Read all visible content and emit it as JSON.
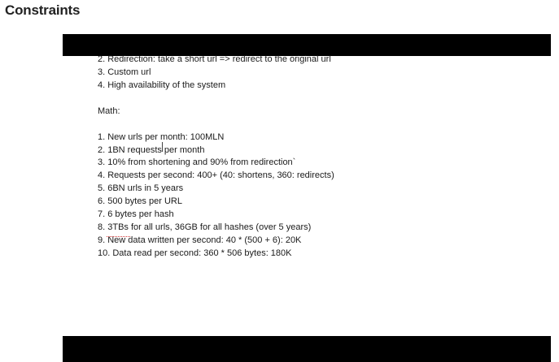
{
  "section": {
    "title": "Constraints"
  },
  "document": {
    "lines": {
      "l2": "2. Redirection: take a short url => redirect to the original url",
      "l3": "3. Custom url",
      "l4": "4. High availability of the system",
      "math_heading": "Math:",
      "m1": "1. New urls per month: 100MLN",
      "m2": "2. 1BN requests per month",
      "m3": "3. 10% from shortening and 90% from redirection`",
      "m4": "4. Requests per second: 400+ (40: shortens, 360: redirects)",
      "m5": "5. 6BN urls in 5 years",
      "m6": "6. 500 bytes per URL",
      "m7": "7. 6 bytes per hash",
      "m8": "8. 3TBs for all urls, 36GB for all hashes (over 5 years)",
      "m9": "9. New data written per second: 40 * (500 + 6): 20K",
      "m10": "10. Data read per second: 360 * 506 bytes: 180K"
    }
  },
  "colors": {
    "bar": "#000000",
    "text": "#1a1a1a",
    "spellcheck": "#d23b3b"
  }
}
